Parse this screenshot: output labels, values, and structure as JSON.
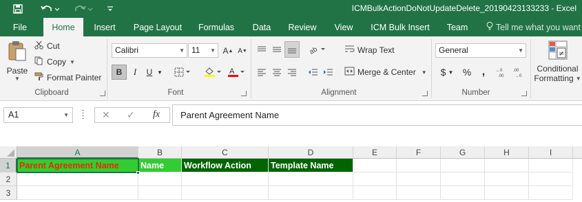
{
  "window": {
    "title": "ICMBulkActionDoNotUpdateDelete_20190423133233 - Excel",
    "quick_access": [
      "save-icon",
      "undo-icon",
      "redo-icon",
      "customize-icon"
    ]
  },
  "tabs": [
    {
      "label": "File",
      "active": false
    },
    {
      "label": "Home",
      "active": true
    },
    {
      "label": "Insert",
      "active": false
    },
    {
      "label": "Page Layout",
      "active": false
    },
    {
      "label": "Formulas",
      "active": false
    },
    {
      "label": "Data",
      "active": false
    },
    {
      "label": "Review",
      "active": false
    },
    {
      "label": "View",
      "active": false
    },
    {
      "label": "ICM Bulk Insert",
      "active": false
    },
    {
      "label": "Team",
      "active": false
    }
  ],
  "tell_me": "Tell me what you want",
  "ribbon": {
    "clipboard": {
      "label": "Clipboard",
      "paste": "Paste",
      "cut": "Cut",
      "copy": "Copy",
      "format_painter": "Format Painter"
    },
    "font": {
      "label": "Font",
      "font_name": "Calibri",
      "font_size": "11",
      "bold": "B",
      "italic": "I",
      "underline": "U"
    },
    "alignment": {
      "label": "Alignment",
      "wrap_text": "Wrap Text",
      "merge_center": "Merge & Center"
    },
    "number": {
      "label": "Number",
      "format": "General"
    },
    "styles": {
      "conditional_formatting_1": "Conditional",
      "conditional_formatting_2": "Formatting"
    }
  },
  "formula_bar": {
    "name_box": "A1",
    "fx": "fx",
    "value": "Parent Agreement Name"
  },
  "grid": {
    "columns": [
      "A",
      "B",
      "C",
      "D",
      "E",
      "F",
      "G",
      "H",
      "I"
    ],
    "rows": [
      "1",
      "2",
      "3"
    ],
    "selected_cell": "A1",
    "row1": [
      "Parent Agreement Name",
      "Name",
      "Workflow Action",
      "Template Name"
    ]
  },
  "colors": {
    "brand": "#217346",
    "header_fill_a1": "#33cc33",
    "header_text_a1": "#e52e00",
    "header_fill_b1": "#33cc33",
    "header_fill_cd": "#006400"
  }
}
